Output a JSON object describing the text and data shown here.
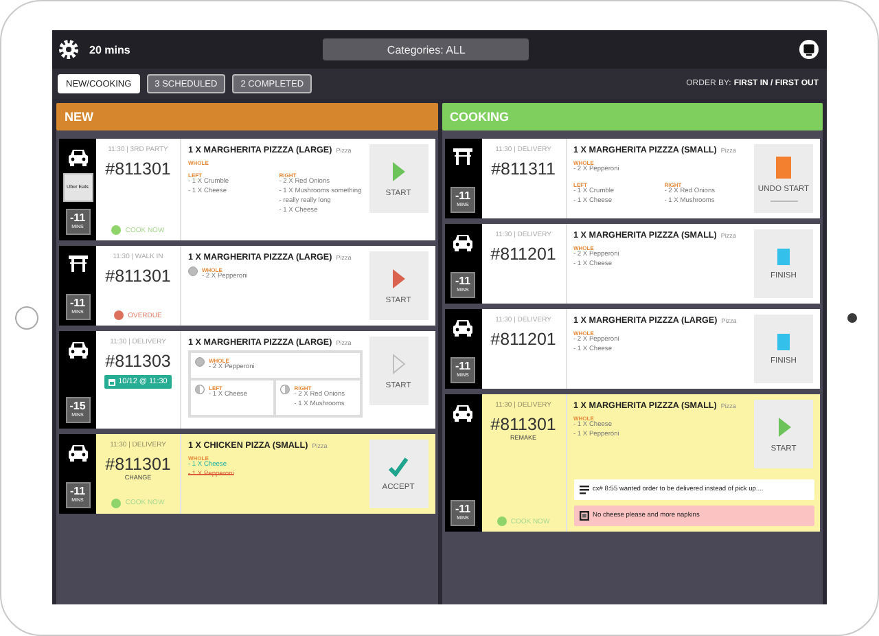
{
  "top_bar": {
    "timer": "20 mins",
    "categories": "Categories: ALL"
  },
  "tabs": [
    {
      "label": "NEW/COOKING",
      "selected": true
    },
    {
      "label": "3 SCHEDULED",
      "selected": false
    },
    {
      "label": "2 COMPLETED",
      "selected": false
    }
  ],
  "order_by": {
    "label": "ORDER BY:",
    "value": "FIRST IN / FIRST OUT"
  },
  "columns": [
    {
      "title": "NEW",
      "color": "#d6862c",
      "cards": [
        {
          "vehicle": {
            "kind": "car"
          },
          "source": "Uber Eats",
          "mins": "-11",
          "mins_unit": "MINS",
          "meta": "11:30 | 3RD PARTY",
          "number": "#811301",
          "highlight": false,
          "status": {
            "kind": "ok",
            "label": "COOK NOW"
          },
          "item": {
            "title": "1 X MARGHERITA PIZZZA (LARGE)",
            "category": "Pizza",
            "boxed": false,
            "portion_icons": false,
            "sections": [
              {
                "kind": "whole",
                "label": "WHOLE"
              },
              {
                "kind": "left",
                "label": "LEFT",
                "lines": [
                  {
                    "text": "- 1 X Crumble",
                    "kind": "plain"
                  },
                  {
                    "text": "- 1 X Cheese",
                    "kind": "plain"
                  }
                ]
              },
              {
                "kind": "right",
                "label": "RIGHT",
                "lines": [
                  {
                    "text": "- 2 X Red Onions",
                    "kind": "plain"
                  },
                  {
                    "text": "- 1 X Mushrooms something - really really long",
                    "kind": "plain"
                  },
                  {
                    "text": "- 1 X Cheese",
                    "kind": "plain"
                  }
                ]
              }
            ]
          },
          "action": {
            "kind": "go",
            "label": "START"
          }
        },
        {
          "vehicle": {
            "kind": "table"
          },
          "mins": "-11",
          "mins_unit": "MINS",
          "meta": "11:30 | WALK IN",
          "number": "#811301",
          "highlight": false,
          "status": {
            "kind": "late",
            "label": "OVERDUE"
          },
          "item": {
            "title": "1 X MARGHERITA PIZZZA (LARGE)",
            "category": "Pizza",
            "boxed": false,
            "portion_icons": true,
            "sections": [
              {
                "kind": "whole",
                "label": "WHOLE",
                "lines": [
                  {
                    "text": "- 2 X Pepperoni",
                    "kind": "plain"
                  }
                ]
              }
            ]
          },
          "action": {
            "kind": "late",
            "label": "START"
          }
        },
        {
          "vehicle": {
            "kind": "car"
          },
          "mins": "-15",
          "mins_unit": "MINS",
          "meta": "11:30 | DELIVERY",
          "number": "#811303",
          "schedule": "10/12 @ 11:30",
          "highlight": false,
          "item": {
            "title": "1 X MARGHERITA PIZZZA (LARGE)",
            "category": "Pizza",
            "boxed": true,
            "portion_icons": true,
            "sections": [
              {
                "kind": "whole",
                "label": "WHOLE",
                "lines": [
                  {
                    "text": "- 2 X Pepperoni",
                    "kind": "plain"
                  }
                ]
              },
              {
                "kind": "left",
                "label": "LEFT",
                "lines": [
                  {
                    "text": "- 1 X Cheese",
                    "kind": "plain"
                  }
                ]
              },
              {
                "kind": "right",
                "label": "RIGHT",
                "lines": [
                  {
                    "text": "- 2 X Red Onions",
                    "kind": "plain"
                  },
                  {
                    "text": "- 1 X Mushrooms",
                    "kind": "plain"
                  }
                ]
              }
            ]
          },
          "action": {
            "kind": "pending",
            "label": "START"
          }
        },
        {
          "vehicle": {
            "kind": "car"
          },
          "mins": "-11",
          "mins_unit": "MINS",
          "meta": "11:30 | DELIVERY",
          "number": "#811301",
          "tag": "CHANGE",
          "highlight": true,
          "status": {
            "kind": "ok",
            "label": "COOK NOW"
          },
          "item": {
            "title": "1 X CHICKEN PIZZA (SMALL)",
            "category": "Pizza",
            "boxed": false,
            "portion_icons": false,
            "sections": [
              {
                "kind": "whole",
                "label": "WHOLE",
                "lines": [
                  {
                    "text": "- 1 X Cheese",
                    "kind": "added"
                  },
                  {
                    "text": "- 1 X Pepperoni",
                    "kind": "removed"
                  }
                ]
              }
            ]
          },
          "action": {
            "kind": "accept",
            "label": "ACCEPT"
          }
        }
      ]
    },
    {
      "title": "COOKING",
      "color": "#7fcf5e",
      "cards": [
        {
          "vehicle": {
            "kind": "table"
          },
          "mins": "-11",
          "mins_unit": "MINS",
          "meta": "11:30 | DELIVERY",
          "number": "#811311",
          "highlight": false,
          "item": {
            "title": "1 X MARGHERITA PIZZZA (SMALL)",
            "category": "Pizza",
            "boxed": false,
            "portion_icons": false,
            "sections": [
              {
                "kind": "whole",
                "label": "WHOLE",
                "lines": [
                  {
                    "text": "- 2 X Pepperoni",
                    "kind": "plain"
                  }
                ]
              },
              {
                "kind": "left",
                "label": "LEFT",
                "lines": [
                  {
                    "text": "- 1 X Crumble",
                    "kind": "plain"
                  },
                  {
                    "text": "- 1 X Cheese",
                    "kind": "plain"
                  }
                ]
              },
              {
                "kind": "right",
                "label": "RIGHT",
                "lines": [
                  {
                    "text": "- 2 X Red Onions",
                    "kind": "plain"
                  },
                  {
                    "text": "- 1 X Mushrooms",
                    "kind": "plain"
                  }
                ]
              }
            ]
          },
          "action": {
            "kind": "undo",
            "label": "UNDO START"
          }
        },
        {
          "vehicle": {
            "kind": "car"
          },
          "mins": "-11",
          "mins_unit": "MINS",
          "meta": "11:30 | DELIVERY",
          "number": "#811201",
          "highlight": false,
          "item": {
            "title": "1 X MARGHERITA PIZZZA (SMALL)",
            "category": "Pizza",
            "boxed": false,
            "portion_icons": false,
            "sections": [
              {
                "kind": "whole",
                "label": "WHOLE",
                "lines": [
                  {
                    "text": "- 2 X Pepperoni",
                    "kind": "plain"
                  },
                  {
                    "text": "- 1 X Cheese",
                    "kind": "plain"
                  }
                ]
              }
            ]
          },
          "action": {
            "kind": "finish",
            "label": "FINISH"
          }
        },
        {
          "vehicle": {
            "kind": "car"
          },
          "mins": "-11",
          "mins_unit": "MINS",
          "meta": "11:30 | DELIVERY",
          "number": "#811201",
          "highlight": false,
          "item": {
            "title": "1 X MARGHERITA PIZZZA (LARGE)",
            "category": "Pizza",
            "boxed": false,
            "portion_icons": false,
            "sections": [
              {
                "kind": "whole",
                "label": "WHOLE",
                "lines": [
                  {
                    "text": "- 2 X Pepperoni",
                    "kind": "plain"
                  },
                  {
                    "text": "- 1 X Cheese",
                    "kind": "plain"
                  }
                ]
              }
            ]
          },
          "action": {
            "kind": "finish",
            "label": "FINISH"
          }
        },
        {
          "vehicle": {
            "kind": "car"
          },
          "mins": "-11",
          "mins_unit": "MINS",
          "meta": "11:30 | DELIVERY",
          "number": "#811301",
          "tag": "REMAKE",
          "highlight": true,
          "status": {
            "kind": "ok",
            "label": "COOK NOW"
          },
          "item": {
            "title": "1 X MARGHERITA PIZZZA (SMALL)",
            "category": "Pizza",
            "boxed": false,
            "portion_icons": false,
            "sections": [
              {
                "kind": "whole",
                "label": "WHOLE",
                "lines": [
                  {
                    "text": "- 1 X Cheese",
                    "kind": "plain"
                  },
                  {
                    "text": "- 1 X Pepperoni",
                    "kind": "plain"
                  }
                ]
              }
            ]
          },
          "action": {
            "kind": "go",
            "label": "START"
          },
          "notes": [
            {
              "kind": "info",
              "text": "cx# 8:55 wanted order to be delivered instead of pick up...."
            },
            {
              "kind": "alert",
              "text": "No cheese please and more napkins"
            }
          ]
        }
      ]
    }
  ]
}
